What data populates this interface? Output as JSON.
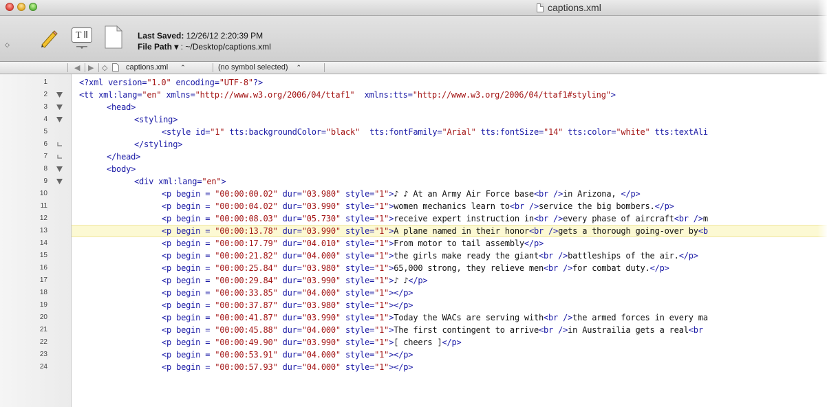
{
  "window": {
    "title": "captions.xml"
  },
  "toolbar": {
    "last_saved_label": "Last Saved:",
    "last_saved_value": "12/26/12 2:20:39 PM",
    "file_path_label": "File Path",
    "file_path_arrow": "▾",
    "file_path_value": " : ~/Desktop/captions.xml",
    "tbox_label": "T Ⅱ"
  },
  "jumpbar": {
    "back": "◀",
    "forward": "▶",
    "diamond": "◇",
    "file": "captions.xml",
    "file_arrows": "⌃",
    "symbol": "(no symbol selected)",
    "symbol_arrows": "⌃"
  },
  "colors": {
    "tag": "#1a1aa6",
    "string": "#a31515",
    "highlight": "#fcf9d3"
  },
  "editor": {
    "highlighted_line": 13,
    "lines": [
      {
        "n": "1",
        "fold": "",
        "indent": 0,
        "parts": [
          [
            "tg",
            "<?xml "
          ],
          [
            "tg",
            "version="
          ],
          [
            "sv",
            "\"1.0\""
          ],
          [
            "tg",
            " encoding="
          ],
          [
            "sv",
            "\"UTF-8\""
          ],
          [
            "tg",
            "?>"
          ]
        ]
      },
      {
        "n": "2",
        "fold": "down",
        "indent": 0,
        "parts": [
          [
            "tg",
            "<tt xml:lang="
          ],
          [
            "sv",
            "\"en\""
          ],
          [
            "tg",
            " xmlns="
          ],
          [
            "sv",
            "\"http://www.w3.org/2006/04/ttaf1\""
          ],
          [
            "tg",
            "  xmlns:tts="
          ],
          [
            "sv",
            "\"http://www.w3.org/2006/04/ttaf1#styling\""
          ],
          [
            "tg",
            ">"
          ]
        ]
      },
      {
        "n": "3",
        "fold": "down",
        "indent": 1,
        "parts": [
          [
            "tg",
            "<head>"
          ]
        ]
      },
      {
        "n": "4",
        "fold": "down",
        "indent": 2,
        "parts": [
          [
            "tg",
            "<styling>"
          ]
        ]
      },
      {
        "n": "5",
        "fold": "",
        "indent": 3,
        "parts": [
          [
            "tg",
            "<style id="
          ],
          [
            "sv",
            "\"1\""
          ],
          [
            "tg",
            " tts:backgroundColor="
          ],
          [
            "sv",
            "\"black\""
          ],
          [
            "tg",
            "  tts:fontFamily="
          ],
          [
            "sv",
            "\"Arial\""
          ],
          [
            "tg",
            " tts:fontSize="
          ],
          [
            "sv",
            "\"14\""
          ],
          [
            "tg",
            " tts:color="
          ],
          [
            "sv",
            "\"white\""
          ],
          [
            "tg",
            " tts:textAli"
          ]
        ]
      },
      {
        "n": "6",
        "fold": "end",
        "indent": 2,
        "parts": [
          [
            "tg",
            "</styling>"
          ]
        ]
      },
      {
        "n": "7",
        "fold": "end",
        "indent": 1,
        "parts": [
          [
            "tg",
            "</head>"
          ]
        ]
      },
      {
        "n": "8",
        "fold": "down",
        "indent": 1,
        "parts": [
          [
            "tg",
            "<body>"
          ]
        ]
      },
      {
        "n": "9",
        "fold": "down",
        "indent": 2,
        "parts": [
          [
            "tg",
            "<div xml:lang="
          ],
          [
            "sv",
            "\"en\""
          ],
          [
            "tg",
            ">"
          ]
        ]
      },
      {
        "n": "10",
        "fold": "",
        "indent": 3,
        "parts": [
          [
            "tg",
            "<p begin = "
          ],
          [
            "sv",
            "\"00:00:00.02\""
          ],
          [
            "tg",
            " dur="
          ],
          [
            "sv",
            "\"03.980\""
          ],
          [
            "tg",
            " style="
          ],
          [
            "sv",
            "\"1\""
          ],
          [
            "tg",
            ">"
          ],
          [
            "tx",
            "♪ ♪ At an Army Air Force base"
          ],
          [
            "tg",
            "<br />"
          ],
          [
            "tx",
            "in Arizona, "
          ],
          [
            "tg",
            "</p>"
          ]
        ]
      },
      {
        "n": "11",
        "fold": "",
        "indent": 3,
        "parts": [
          [
            "tg",
            "<p begin = "
          ],
          [
            "sv",
            "\"00:00:04.02\""
          ],
          [
            "tg",
            " dur="
          ],
          [
            "sv",
            "\"03.990\""
          ],
          [
            "tg",
            " style="
          ],
          [
            "sv",
            "\"1\""
          ],
          [
            "tg",
            ">"
          ],
          [
            "tx",
            "women mechanics learn to"
          ],
          [
            "tg",
            "<br />"
          ],
          [
            "tx",
            "service the big bombers."
          ],
          [
            "tg",
            "</p>"
          ]
        ]
      },
      {
        "n": "12",
        "fold": "",
        "indent": 3,
        "parts": [
          [
            "tg",
            "<p begin = "
          ],
          [
            "sv",
            "\"00:00:08.03\""
          ],
          [
            "tg",
            " dur="
          ],
          [
            "sv",
            "\"05.730\""
          ],
          [
            "tg",
            " style="
          ],
          [
            "sv",
            "\"1\""
          ],
          [
            "tg",
            ">"
          ],
          [
            "tx",
            "receive expert instruction in"
          ],
          [
            "tg",
            "<br />"
          ],
          [
            "tx",
            "every phase of aircraft"
          ],
          [
            "tg",
            "<br />"
          ],
          [
            "tx",
            "m"
          ]
        ]
      },
      {
        "n": "13",
        "fold": "",
        "indent": 3,
        "parts": [
          [
            "tg",
            "<p begin = "
          ],
          [
            "sv",
            "\"00:00:13.78\""
          ],
          [
            "tg",
            " dur="
          ],
          [
            "sv",
            "\"03.990\""
          ],
          [
            "tg",
            " style="
          ],
          [
            "sv",
            "\"1\""
          ],
          [
            "tg",
            ">"
          ],
          [
            "tx",
            "A plane named in their honor"
          ],
          [
            "tg",
            "<br />"
          ],
          [
            "tx",
            "gets a thorough going-over by"
          ],
          [
            "tg",
            "<b"
          ]
        ]
      },
      {
        "n": "14",
        "fold": "",
        "indent": 3,
        "parts": [
          [
            "tg",
            "<p begin = "
          ],
          [
            "sv",
            "\"00:00:17.79\""
          ],
          [
            "tg",
            " dur="
          ],
          [
            "sv",
            "\"04.010\""
          ],
          [
            "tg",
            " style="
          ],
          [
            "sv",
            "\"1\""
          ],
          [
            "tg",
            ">"
          ],
          [
            "tx",
            "From motor to tail assembly"
          ],
          [
            "tg",
            "</p>"
          ]
        ]
      },
      {
        "n": "15",
        "fold": "",
        "indent": 3,
        "parts": [
          [
            "tg",
            "<p begin = "
          ],
          [
            "sv",
            "\"00:00:21.82\""
          ],
          [
            "tg",
            " dur="
          ],
          [
            "sv",
            "\"04.000\""
          ],
          [
            "tg",
            " style="
          ],
          [
            "sv",
            "\"1\""
          ],
          [
            "tg",
            ">"
          ],
          [
            "tx",
            "the girls make ready the giant"
          ],
          [
            "tg",
            "<br />"
          ],
          [
            "tx",
            "battleships of the air."
          ],
          [
            "tg",
            "</p>"
          ]
        ]
      },
      {
        "n": "16",
        "fold": "",
        "indent": 3,
        "parts": [
          [
            "tg",
            "<p begin = "
          ],
          [
            "sv",
            "\"00:00:25.84\""
          ],
          [
            "tg",
            " dur="
          ],
          [
            "sv",
            "\"03.980\""
          ],
          [
            "tg",
            " style="
          ],
          [
            "sv",
            "\"1\""
          ],
          [
            "tg",
            ">"
          ],
          [
            "tx",
            "65,000 strong, they relieve men"
          ],
          [
            "tg",
            "<br />"
          ],
          [
            "tx",
            "for combat duty."
          ],
          [
            "tg",
            "</p>"
          ]
        ]
      },
      {
        "n": "17",
        "fold": "",
        "indent": 3,
        "parts": [
          [
            "tg",
            "<p begin = "
          ],
          [
            "sv",
            "\"00:00:29.84\""
          ],
          [
            "tg",
            " dur="
          ],
          [
            "sv",
            "\"03.990\""
          ],
          [
            "tg",
            " style="
          ],
          [
            "sv",
            "\"1\""
          ],
          [
            "tg",
            ">"
          ],
          [
            "tx",
            "♪ ♪"
          ],
          [
            "tg",
            "</p>"
          ]
        ]
      },
      {
        "n": "18",
        "fold": "",
        "indent": 3,
        "parts": [
          [
            "tg",
            "<p begin = "
          ],
          [
            "sv",
            "\"00:00:33.85\""
          ],
          [
            "tg",
            " dur="
          ],
          [
            "sv",
            "\"04.000\""
          ],
          [
            "tg",
            " style="
          ],
          [
            "sv",
            "\"1\""
          ],
          [
            "tg",
            ">"
          ],
          [
            "tg",
            "</p>"
          ]
        ]
      },
      {
        "n": "19",
        "fold": "",
        "indent": 3,
        "parts": [
          [
            "tg",
            "<p begin = "
          ],
          [
            "sv",
            "\"00:00:37.87\""
          ],
          [
            "tg",
            " dur="
          ],
          [
            "sv",
            "\"03.980\""
          ],
          [
            "tg",
            " style="
          ],
          [
            "sv",
            "\"1\""
          ],
          [
            "tg",
            ">"
          ],
          [
            "tg",
            "</p>"
          ]
        ]
      },
      {
        "n": "20",
        "fold": "",
        "indent": 3,
        "parts": [
          [
            "tg",
            "<p begin = "
          ],
          [
            "sv",
            "\"00:00:41.87\""
          ],
          [
            "tg",
            " dur="
          ],
          [
            "sv",
            "\"03.990\""
          ],
          [
            "tg",
            " style="
          ],
          [
            "sv",
            "\"1\""
          ],
          [
            "tg",
            ">"
          ],
          [
            "tx",
            "Today the WACs are serving with"
          ],
          [
            "tg",
            "<br />"
          ],
          [
            "tx",
            "the armed forces in every ma"
          ]
        ]
      },
      {
        "n": "21",
        "fold": "",
        "indent": 3,
        "parts": [
          [
            "tg",
            "<p begin = "
          ],
          [
            "sv",
            "\"00:00:45.88\""
          ],
          [
            "tg",
            " dur="
          ],
          [
            "sv",
            "\"04.000\""
          ],
          [
            "tg",
            " style="
          ],
          [
            "sv",
            "\"1\""
          ],
          [
            "tg",
            ">"
          ],
          [
            "tx",
            "The first contingent to arrive"
          ],
          [
            "tg",
            "<br />"
          ],
          [
            "tx",
            "in Austrailia gets a real"
          ],
          [
            "tg",
            "<br"
          ]
        ]
      },
      {
        "n": "22",
        "fold": "",
        "indent": 3,
        "parts": [
          [
            "tg",
            "<p begin = "
          ],
          [
            "sv",
            "\"00:00:49.90\""
          ],
          [
            "tg",
            " dur="
          ],
          [
            "sv",
            "\"03.990\""
          ],
          [
            "tg",
            " style="
          ],
          [
            "sv",
            "\"1\""
          ],
          [
            "tg",
            ">"
          ],
          [
            "tx",
            "[ cheers ]"
          ],
          [
            "tg",
            "</p>"
          ]
        ]
      },
      {
        "n": "23",
        "fold": "",
        "indent": 3,
        "parts": [
          [
            "tg",
            "<p begin = "
          ],
          [
            "sv",
            "\"00:00:53.91\""
          ],
          [
            "tg",
            " dur="
          ],
          [
            "sv",
            "\"04.000\""
          ],
          [
            "tg",
            " style="
          ],
          [
            "sv",
            "\"1\""
          ],
          [
            "tg",
            ">"
          ],
          [
            "tg",
            "</p>"
          ]
        ]
      },
      {
        "n": "24",
        "fold": "",
        "indent": 3,
        "parts": [
          [
            "tg",
            "<p begin = "
          ],
          [
            "sv",
            "\"00:00:57.93\""
          ],
          [
            "tg",
            " dur="
          ],
          [
            "sv",
            "\"04.000\""
          ],
          [
            "tg",
            " style="
          ],
          [
            "sv",
            "\"1\""
          ],
          [
            "tg",
            ">"
          ],
          [
            "tg",
            "</p>"
          ]
        ]
      }
    ]
  }
}
